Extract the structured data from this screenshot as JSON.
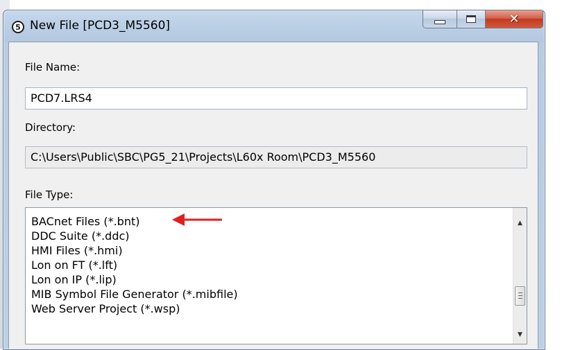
{
  "window": {
    "title": "New File [PCD3_M5560]",
    "icon": "saia-pg5-logo-icon",
    "controls": [
      "minimize-icon",
      "maximize-icon",
      "close-icon"
    ]
  },
  "form": {
    "file_name_label": "File Name:",
    "file_name_value": "PCD7.LRS4",
    "directory_label": "Directory:",
    "directory_value": "C:\\Users\\Public\\SBC\\PG5_21\\Projects\\L60x Room\\PCD3_M5560",
    "file_type_label": "File Type:",
    "file_types": [
      "BACnet Files (*.bnt)",
      "DDC Suite (*.ddc)",
      "HMI Files (*.hmi)",
      "Lon on FT (*.lft)",
      "Lon on IP (*.lip)",
      "MIB Symbol File Generator (*.mibfile)",
      "Web Server Project (*.wsp)"
    ]
  },
  "annotation": {
    "arrow_color": "#e02020"
  },
  "colors": {
    "close_button": "#c7432a",
    "title_bar": "#bdd1e6"
  }
}
